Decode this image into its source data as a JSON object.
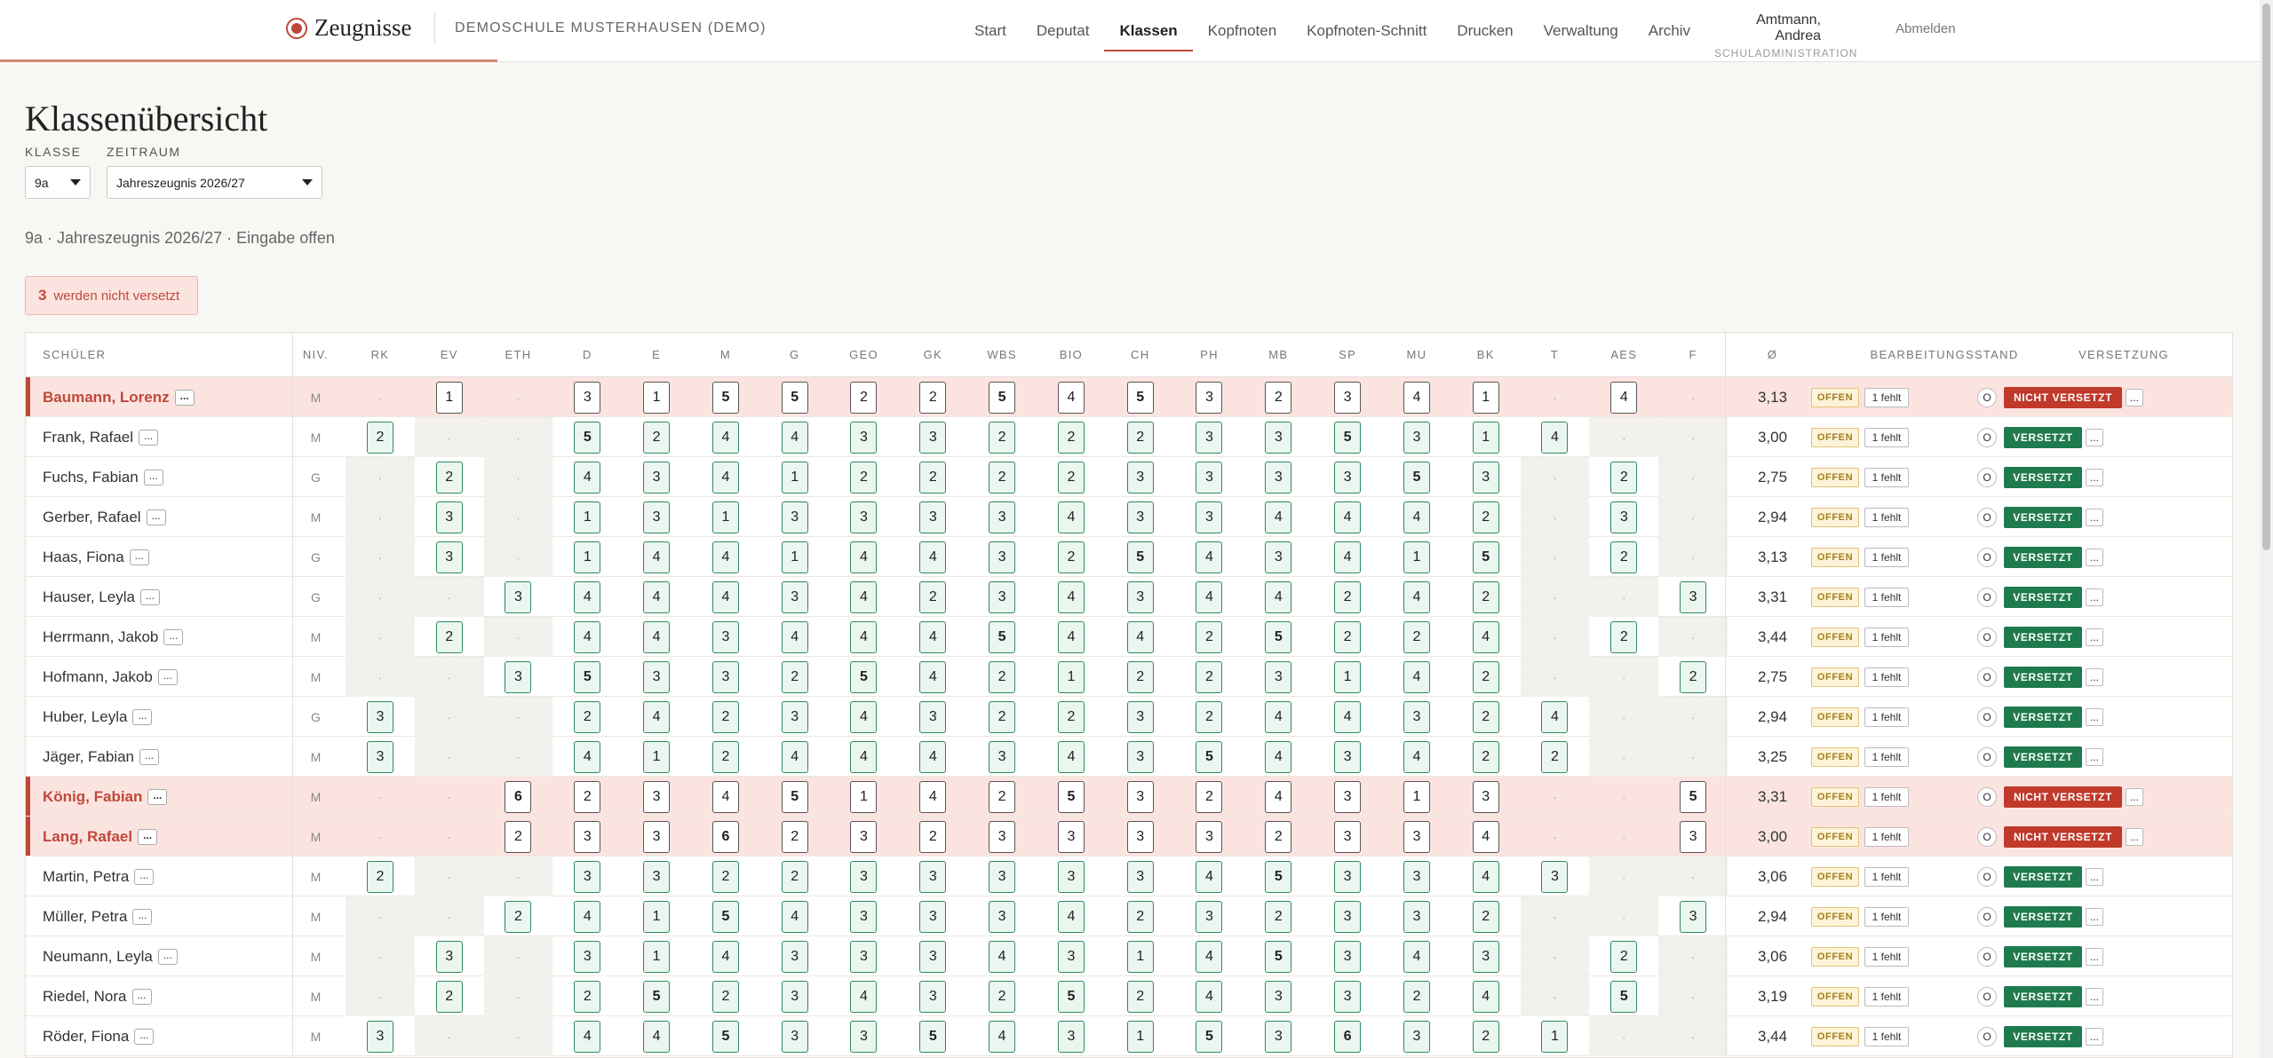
{
  "app": {
    "name": "Zeugnisse",
    "school": "DEMOSCHULE MUSTERHAUSEN (DEMO)",
    "nav": [
      "Start",
      "Deputat",
      "Klassen",
      "Kopfnoten",
      "Kopfnoten-Schnitt",
      "Drucken",
      "Verwaltung",
      "Archiv"
    ],
    "active_nav": "Klassen",
    "user_name": "Amtmann, Andrea",
    "user_role": "SCHULADMINISTRATION",
    "logout": "Abmelden"
  },
  "page": {
    "title": "Klassenübersicht",
    "klasse_label": "KLASSE",
    "klasse_value": "9a",
    "zeitraum_label": "ZEITRAUM",
    "zeitraum_value": "Jahreszeugnis 2026/27",
    "status_line": "9a · Jahreszeugnis 2026/27 · Eingabe offen",
    "alert_count": "3",
    "alert_text": "werden nicht versetzt"
  },
  "table": {
    "header_student": "SCHÜLER",
    "header_niveau": "NIV.",
    "subjects": [
      "RK",
      "EV",
      "ETH",
      "D",
      "E",
      "M",
      "G",
      "GEO",
      "GK",
      "WBS",
      "BIO",
      "CH",
      "PH",
      "MB",
      "SP",
      "MU",
      "BK",
      "T",
      "AES",
      "F"
    ],
    "header_avg": "Ø",
    "header_state": "BEARBEITUNGSSTAND",
    "header_versetzung": "VERSETZUNG",
    "hatched_columns": [
      "RK",
      "EV",
      "ETH",
      "T",
      "AES",
      "F"
    ],
    "empty_mark": "·",
    "more_label": "...",
    "offen_label": "OFFEN",
    "fehlt_label": "1 fehlt",
    "circle_label": "O",
    "versetzt_label": "VERSETZT",
    "nicht_versetzt_label": "NICHT VERSETZT",
    "rows": [
      {
        "name": "Baumann, Lorenz",
        "niv": "M",
        "red": true,
        "avg": "3,13",
        "versetzt": false,
        "grades": [
          "",
          "1",
          "",
          "3",
          "1",
          "5",
          "5",
          "2",
          "2",
          "5",
          "4",
          "5",
          "3",
          "2",
          "3",
          "4",
          "1",
          "",
          "4",
          ""
        ]
      },
      {
        "name": "Frank, Rafael",
        "niv": "M",
        "red": false,
        "avg": "3,00",
        "versetzt": true,
        "grades": [
          "2",
          "",
          "",
          "5",
          "2",
          "4",
          "4",
          "3",
          "3",
          "2",
          "2",
          "2",
          "3",
          "3",
          "5",
          "3",
          "1",
          "4",
          "",
          ""
        ]
      },
      {
        "name": "Fuchs, Fabian",
        "niv": "G",
        "red": false,
        "avg": "2,75",
        "versetzt": true,
        "grades": [
          "",
          "2",
          "",
          "4",
          "3",
          "4",
          "1",
          "2",
          "2",
          "2",
          "2",
          "3",
          "3",
          "3",
          "3",
          "5",
          "3",
          "",
          "2",
          ""
        ]
      },
      {
        "name": "Gerber, Rafael",
        "niv": "M",
        "red": false,
        "avg": "2,94",
        "versetzt": true,
        "grades": [
          "",
          "3",
          "",
          "1",
          "3",
          "1",
          "3",
          "3",
          "3",
          "3",
          "4",
          "3",
          "3",
          "4",
          "4",
          "4",
          "2",
          "",
          "3",
          ""
        ]
      },
      {
        "name": "Haas, Fiona",
        "niv": "G",
        "red": false,
        "avg": "3,13",
        "versetzt": true,
        "grades": [
          "",
          "3",
          "",
          "1",
          "4",
          "4",
          "1",
          "4",
          "4",
          "3",
          "2",
          "5",
          "4",
          "3",
          "4",
          "1",
          "5",
          "",
          "2",
          ""
        ]
      },
      {
        "name": "Hauser, Leyla",
        "niv": "G",
        "red": false,
        "avg": "3,31",
        "versetzt": true,
        "grades": [
          "",
          "",
          "3",
          "4",
          "4",
          "4",
          "3",
          "4",
          "2",
          "3",
          "4",
          "3",
          "4",
          "4",
          "2",
          "4",
          "2",
          "",
          "",
          "3"
        ]
      },
      {
        "name": "Herrmann, Jakob",
        "niv": "M",
        "red": false,
        "avg": "3,44",
        "versetzt": true,
        "grades": [
          "",
          "2",
          "",
          "4",
          "4",
          "3",
          "4",
          "4",
          "4",
          "5",
          "4",
          "4",
          "2",
          "5",
          "2",
          "2",
          "4",
          "",
          "2",
          ""
        ]
      },
      {
        "name": "Hofmann, Jakob",
        "niv": "M",
        "red": false,
        "avg": "2,75",
        "versetzt": true,
        "grades": [
          "",
          "",
          "3",
          "5",
          "3",
          "3",
          "2",
          "5",
          "4",
          "2",
          "1",
          "2",
          "2",
          "3",
          "1",
          "4",
          "2",
          "",
          "",
          "2"
        ]
      },
      {
        "name": "Huber, Leyla",
        "niv": "G",
        "red": false,
        "avg": "2,94",
        "versetzt": true,
        "grades": [
          "3",
          "",
          "",
          "2",
          "4",
          "2",
          "3",
          "4",
          "3",
          "2",
          "2",
          "3",
          "2",
          "4",
          "4",
          "3",
          "2",
          "4",
          "",
          ""
        ]
      },
      {
        "name": "Jäger, Fabian",
        "niv": "M",
        "red": false,
        "avg": "3,25",
        "versetzt": true,
        "grades": [
          "3",
          "",
          "",
          "4",
          "1",
          "2",
          "4",
          "4",
          "4",
          "3",
          "4",
          "3",
          "5",
          "4",
          "3",
          "4",
          "2",
          "2",
          "",
          ""
        ]
      },
      {
        "name": "König, Fabian",
        "niv": "M",
        "red": true,
        "avg": "3,31",
        "versetzt": false,
        "grades": [
          "",
          "",
          "6",
          "2",
          "3",
          "4",
          "5",
          "1",
          "4",
          "2",
          "5",
          "3",
          "2",
          "4",
          "3",
          "1",
          "3",
          "",
          "",
          "5"
        ]
      },
      {
        "name": "Lang, Rafael",
        "niv": "M",
        "red": true,
        "avg": "3,00",
        "versetzt": false,
        "grades": [
          "",
          "",
          "2",
          "3",
          "3",
          "6",
          "2",
          "3",
          "2",
          "3",
          "3",
          "3",
          "3",
          "2",
          "3",
          "3",
          "4",
          "",
          "",
          "3"
        ]
      },
      {
        "name": "Martin, Petra",
        "niv": "M",
        "red": false,
        "avg": "3,06",
        "versetzt": true,
        "grades": [
          "2",
          "",
          "",
          "3",
          "3",
          "2",
          "2",
          "3",
          "3",
          "3",
          "3",
          "3",
          "4",
          "5",
          "3",
          "3",
          "4",
          "3",
          "",
          ""
        ]
      },
      {
        "name": "Müller, Petra",
        "niv": "M",
        "red": false,
        "avg": "2,94",
        "versetzt": true,
        "grades": [
          "",
          "",
          "2",
          "4",
          "1",
          "5",
          "4",
          "3",
          "3",
          "3",
          "4",
          "2",
          "3",
          "2",
          "3",
          "3",
          "2",
          "",
          "",
          "3"
        ]
      },
      {
        "name": "Neumann, Leyla",
        "niv": "M",
        "red": false,
        "avg": "3,06",
        "versetzt": true,
        "grades": [
          "",
          "3",
          "",
          "3",
          "1",
          "4",
          "3",
          "3",
          "3",
          "4",
          "3",
          "1",
          "4",
          "5",
          "3",
          "4",
          "3",
          "",
          "2",
          ""
        ]
      },
      {
        "name": "Riedel, Nora",
        "niv": "M",
        "red": false,
        "avg": "3,19",
        "versetzt": true,
        "grades": [
          "",
          "2",
          "",
          "2",
          "5",
          "2",
          "3",
          "4",
          "3",
          "2",
          "5",
          "2",
          "4",
          "3",
          "3",
          "2",
          "4",
          "",
          "5",
          ""
        ]
      },
      {
        "name": "Röder, Fiona",
        "niv": "M",
        "red": false,
        "avg": "3,44",
        "versetzt": true,
        "grades": [
          "3",
          "",
          "",
          "4",
          "4",
          "5",
          "3",
          "3",
          "5",
          "4",
          "3",
          "1",
          "5",
          "3",
          "6",
          "3",
          "2",
          "1",
          "",
          ""
        ]
      }
    ]
  }
}
